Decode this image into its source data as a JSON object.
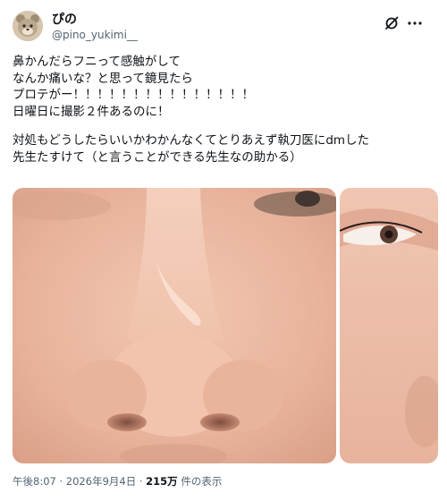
{
  "user": {
    "display_name": "ぴの",
    "handle": "@pino_yukimi__"
  },
  "tweet": {
    "lines": [
      "鼻かんだらフニって感触がして",
      "なんか痛いな？と思って鏡見たら",
      "プロテがー！！！！！！！！！！！！！！！",
      "日曜日に撮影２件あるのに！",
      "",
      "対処もどうしたらいいかわかんなくてとりあえず執刀医にdmした",
      "先生たすけて（と言うことができる先生なの助かる）"
    ]
  },
  "meta": {
    "time": "午後8:07",
    "sep1": " · ",
    "date": "2026年9月4日",
    "sep2": " · ",
    "views_count": "215万",
    "views_label": " 件の表示"
  },
  "icons": {
    "grok": "grok-icon",
    "more": "more-icon"
  },
  "colors": {
    "text": "#0f1419",
    "secondary": "#536471",
    "skin": "#e9b9a2"
  }
}
